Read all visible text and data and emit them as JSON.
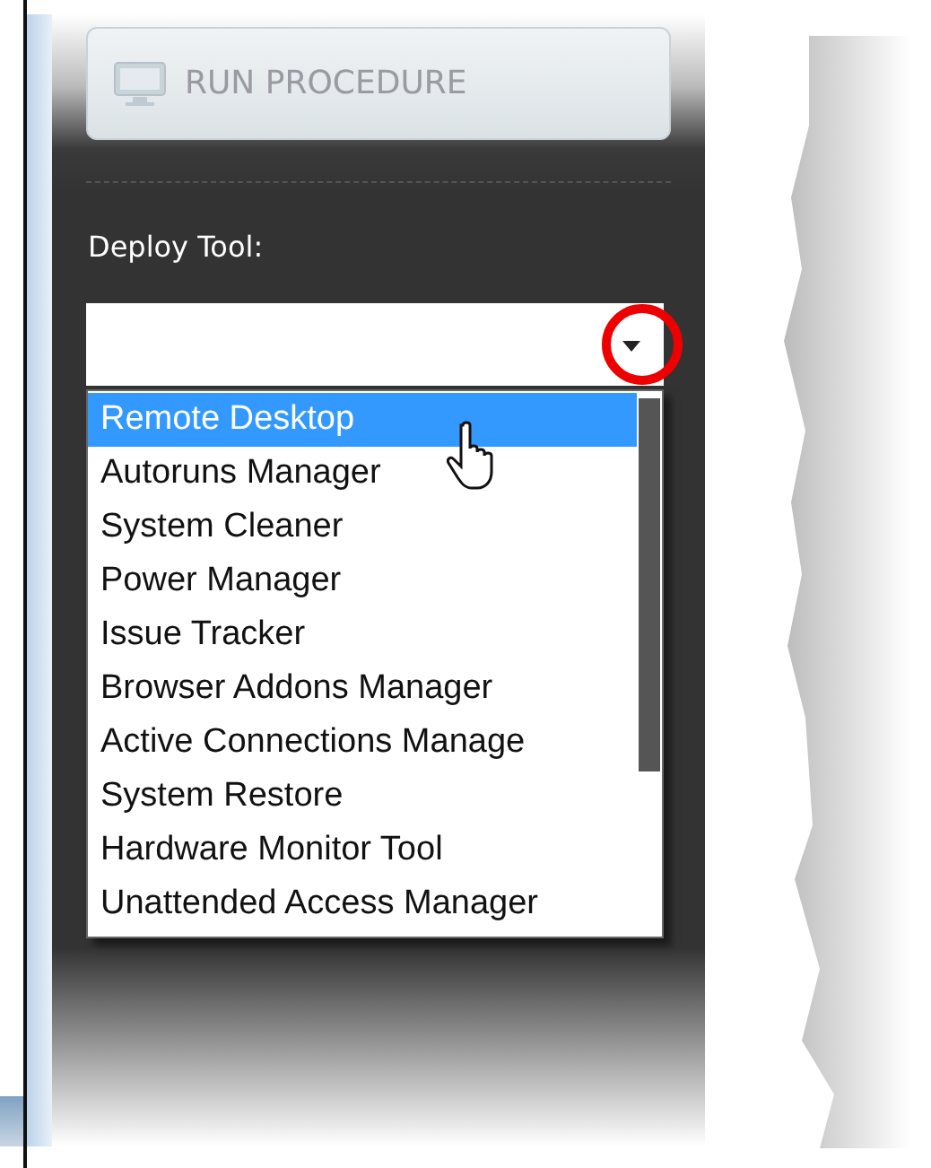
{
  "run_button": {
    "label": "RUN PROCEDURE",
    "disabled": true
  },
  "deploy_tool": {
    "label": "Deploy Tool:",
    "options": [
      {
        "label": "Remote Desktop",
        "selected": true
      },
      {
        "label": "Autoruns Manager",
        "selected": false
      },
      {
        "label": "System Cleaner",
        "selected": false
      },
      {
        "label": "Power Manager",
        "selected": false
      },
      {
        "label": "Issue Tracker",
        "selected": false
      },
      {
        "label": "Browser Addons Manager",
        "selected": false
      },
      {
        "label": "Active Connections Manage",
        "selected": false
      },
      {
        "label": "System Restore",
        "selected": false
      },
      {
        "label": "Hardware Monitor Tool",
        "selected": false
      },
      {
        "label": "Unattended Access Manager",
        "selected": false
      }
    ]
  }
}
